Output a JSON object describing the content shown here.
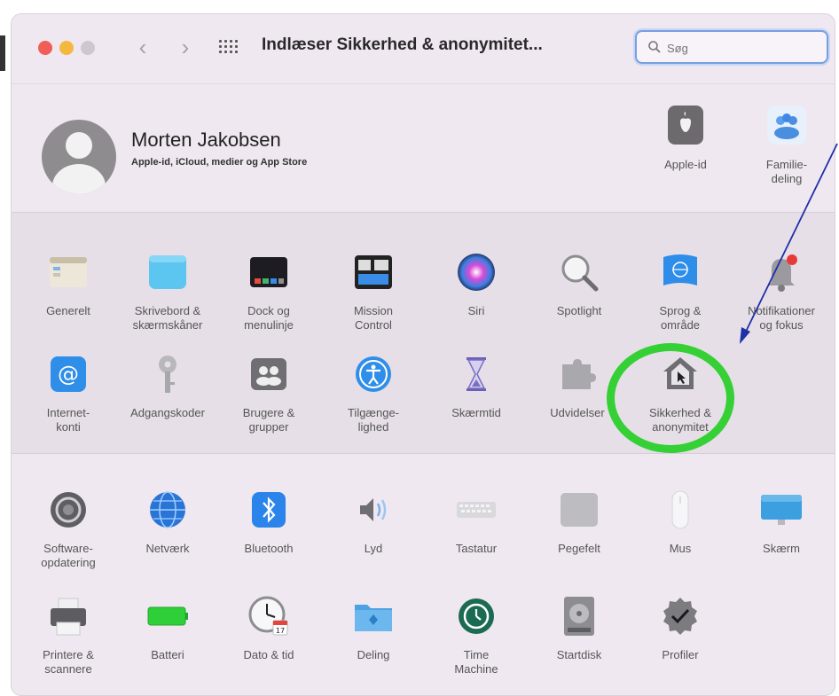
{
  "window": {
    "title": "Indlæser Sikkerhed & anonymitet...",
    "search_placeholder": "Søg",
    "traffic_lights": {
      "close": "#ef5e57",
      "minimize": "#f4b83f",
      "zoom": "#cdc7ce"
    }
  },
  "account": {
    "name": "Morten Jakobsen",
    "subtitle": "Apple-id, iCloud, medier og App Store",
    "apple_id_label": "Apple-id",
    "family_label": "Familie-\ndeling"
  },
  "section1": [
    {
      "label": "Generelt",
      "icon": "general-icon"
    },
    {
      "label": "Skrivebord &\nskærmskåner",
      "icon": "desktop-icon"
    },
    {
      "label": "Dock og\nmenulinje",
      "icon": "dock-icon"
    },
    {
      "label": "Mission\nControl",
      "icon": "mission-control-icon"
    },
    {
      "label": "Siri",
      "icon": "siri-icon"
    },
    {
      "label": "Spotlight",
      "icon": "spotlight-icon"
    },
    {
      "label": "Sprog &\nområde",
      "icon": "language-icon"
    },
    {
      "label": "Notifikationer\nog fokus",
      "icon": "notifications-icon"
    },
    {
      "label": "Internet-\nkonti",
      "icon": "internet-accounts-icon"
    },
    {
      "label": "Adgangskoder",
      "icon": "passwords-icon"
    },
    {
      "label": "Brugere &\ngrupper",
      "icon": "users-icon"
    },
    {
      "label": "Tilgænge-\nlighed",
      "icon": "accessibility-icon"
    },
    {
      "label": "Skærmtid",
      "icon": "screen-time-icon"
    },
    {
      "label": "Udvidelser",
      "icon": "extensions-icon"
    },
    {
      "label": "Sikkerhed &\nanonymitet",
      "icon": "security-icon"
    }
  ],
  "section2": [
    {
      "label": "Software-\nopdatering",
      "icon": "software-update-icon"
    },
    {
      "label": "Netværk",
      "icon": "network-icon"
    },
    {
      "label": "Bluetooth",
      "icon": "bluetooth-icon"
    },
    {
      "label": "Lyd",
      "icon": "sound-icon"
    },
    {
      "label": "Tastatur",
      "icon": "keyboard-icon"
    },
    {
      "label": "Pegefelt",
      "icon": "trackpad-icon"
    },
    {
      "label": "Mus",
      "icon": "mouse-icon"
    },
    {
      "label": "Skærm",
      "icon": "display-icon"
    },
    {
      "label": "Printere &\nscannere",
      "icon": "printer-icon"
    },
    {
      "label": "Batteri",
      "icon": "battery-icon"
    },
    {
      "label": "Dato & tid",
      "icon": "date-time-icon"
    },
    {
      "label": "Deling",
      "icon": "sharing-icon"
    },
    {
      "label": "Time\nMachine",
      "icon": "time-machine-icon"
    },
    {
      "label": "Startdisk",
      "icon": "startup-disk-icon"
    },
    {
      "label": "Profiler",
      "icon": "profiles-icon"
    }
  ],
  "annotation": {
    "highlight_color": "#35d035",
    "arrow_color": "#1f2fa8"
  }
}
